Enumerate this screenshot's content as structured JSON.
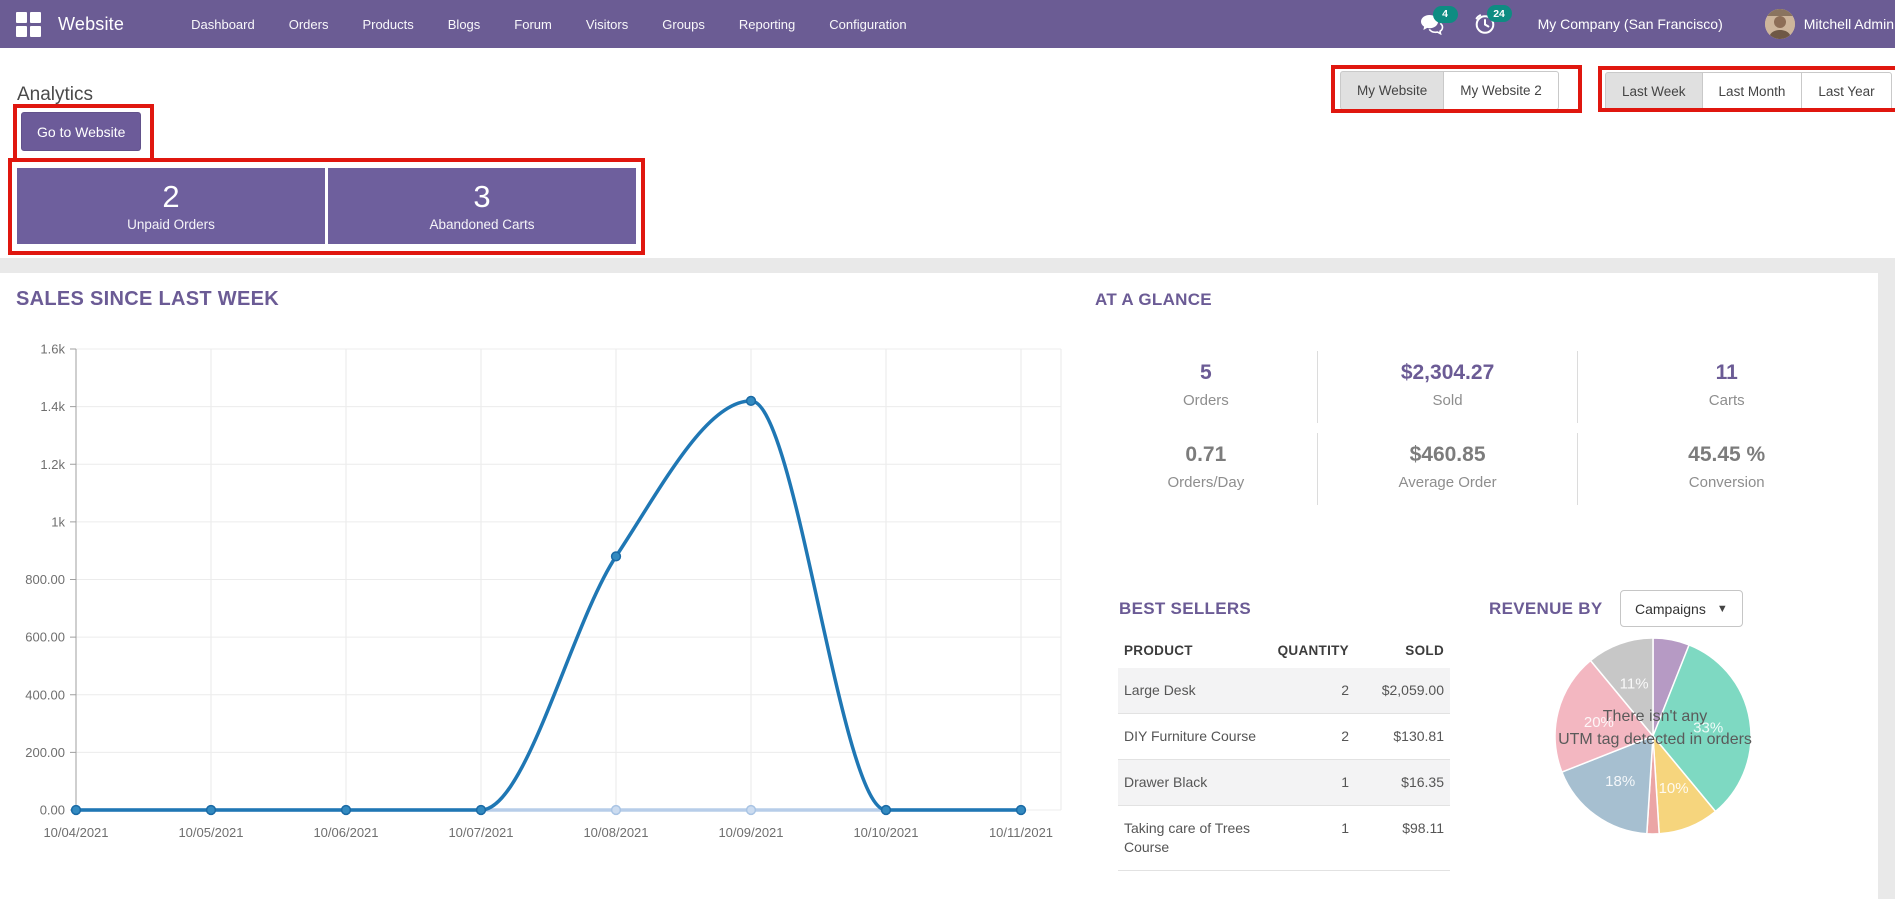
{
  "navbar": {
    "brand": "Website",
    "menu": [
      "Dashboard",
      "Orders",
      "Products",
      "Blogs",
      "Forum",
      "Visitors",
      "Groups",
      "Reporting",
      "Configuration"
    ],
    "messages_badge": "4",
    "activities_badge": "24",
    "company": "My Company (San Francisco)",
    "user": "Mitchell Admin",
    "bg_color": "#6b5c94",
    "badge_color": "#0e8c82"
  },
  "header": {
    "title": "Analytics",
    "go_to_website": "Go to Website",
    "website_switcher": [
      "My Website",
      "My Website 2"
    ],
    "website_active": "My Website",
    "period_switcher": [
      "Last Week",
      "Last Month",
      "Last Year"
    ],
    "period_active": "Last Week",
    "stats": [
      {
        "value": "2",
        "label": "Unpaid Orders"
      },
      {
        "value": "3",
        "label": "Abandoned Carts"
      }
    ],
    "stat_card_color": "#6e5f9d"
  },
  "glance": {
    "heading": "AT A GLANCE",
    "rows": [
      [
        {
          "value": "5",
          "label": "Orders"
        },
        {
          "value": "$2,304.27",
          "label": "Sold"
        },
        {
          "value": "11",
          "label": "Carts"
        }
      ],
      [
        {
          "value": "0.71",
          "label": "Orders/Day"
        },
        {
          "value": "$460.85",
          "label": "Average Order"
        },
        {
          "value": "45.45 %",
          "label": "Conversion"
        }
      ]
    ]
  },
  "best_sellers": {
    "heading": "BEST SELLERS",
    "columns": [
      "PRODUCT",
      "QUANTITY",
      "SOLD"
    ],
    "rows": [
      {
        "product": "Large Desk",
        "quantity": "2",
        "sold": "$2,059.00"
      },
      {
        "product": "DIY Furniture Course",
        "quantity": "2",
        "sold": "$130.81"
      },
      {
        "product": "Drawer Black",
        "quantity": "1",
        "sold": "$16.35"
      },
      {
        "product": "Taking care of Trees Course",
        "quantity": "1",
        "sold": "$98.11"
      }
    ]
  },
  "annotations": {
    "color": "#e0170f"
  },
  "chart_data": [
    {
      "type": "line",
      "title": "SALES SINCE LAST WEEK",
      "x": [
        "10/04/2021",
        "10/05/2021",
        "10/06/2021",
        "10/07/2021",
        "10/08/2021",
        "10/09/2021",
        "10/10/2021",
        "10/11/2021"
      ],
      "series": [
        {
          "name": "sales_current_week",
          "color": "#1f77b4",
          "dot_fill": "#338ac0",
          "dot_stroke": "#1a6aa5",
          "values": [
            0,
            0,
            0,
            0,
            880,
            1420,
            0,
            0
          ]
        },
        {
          "name": "sales_previous_week",
          "color": "#b7cde9",
          "dot_fill": "#ccdcf0",
          "dot_stroke": "#a9c4e4",
          "values": [
            0,
            0,
            0,
            0,
            0,
            0,
            0,
            0
          ]
        }
      ],
      "ylim": [
        0,
        1600
      ],
      "yticks": [
        "1.6k",
        "1.4k",
        "1.2k",
        "1k",
        "800.00",
        "600.00",
        "400.00",
        "200.00",
        "0.00"
      ],
      "grid": true,
      "legend": "none"
    },
    {
      "type": "pie",
      "title": "REVENUE BY",
      "selector_label": "Campaigns",
      "overlay_line1": "There isn't any",
      "overlay_line2": "UTM tag detected in orders",
      "slices": [
        {
          "label": "",
          "value": 6,
          "color": "#b69ac4"
        },
        {
          "label": "33%",
          "value": 33,
          "color": "#7ed9c2"
        },
        {
          "label": "10%",
          "value": 10,
          "color": "#f6d57d"
        },
        {
          "label": "",
          "value": 2,
          "color": "#eba5a5"
        },
        {
          "label": "18%",
          "value": 18,
          "color": "#a6bfd0"
        },
        {
          "label": "20%",
          "value": 20,
          "color": "#f3b7c1"
        },
        {
          "label": "11%",
          "value": 11,
          "color": "#c7c7c7"
        }
      ]
    }
  ]
}
